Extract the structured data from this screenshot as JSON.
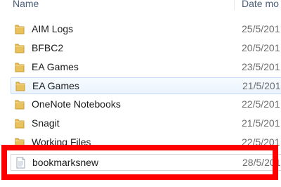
{
  "header": {
    "name_label": "Name",
    "date_label": "Date mo"
  },
  "rows": [
    {
      "name": "AIM Logs",
      "date": "25/5/201",
      "type": "folder"
    },
    {
      "name": "BFBC2",
      "date": "20/5/201",
      "type": "folder"
    },
    {
      "name": "EA Games",
      "date": "23/5/201",
      "type": "folder"
    },
    {
      "name": "EA Games",
      "date": "21/5/201",
      "type": "folder",
      "selected": true
    },
    {
      "name": "OneNote Notebooks",
      "date": "22/5/201",
      "type": "folder"
    },
    {
      "name": "Snagit",
      "date": "21/5/201",
      "type": "folder"
    },
    {
      "name": "Working Files",
      "date": "22/5/201",
      "type": "folder"
    },
    {
      "name": "bookmarksnew",
      "date": "28/5/201",
      "type": "file"
    }
  ],
  "colors": {
    "highlight": "#ff0000",
    "folder": "#e9c15d",
    "selection": "#eaf3fd"
  }
}
